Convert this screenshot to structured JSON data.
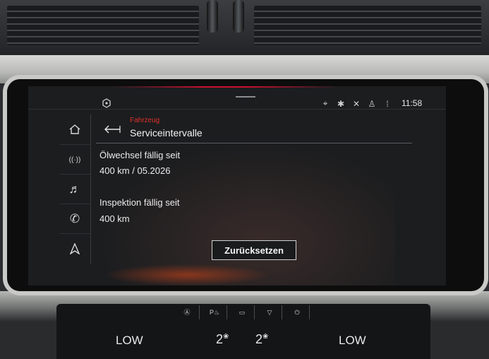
{
  "status_bar": {
    "time": "11:58",
    "icons": [
      "car-icon",
      "location-icon",
      "bluetooth-icon",
      "mute-icon",
      "user-icon",
      "signal-icon"
    ]
  },
  "sidebar": {
    "items": [
      {
        "icon": "home-icon",
        "glyph": "⌂"
      },
      {
        "icon": "radio-icon",
        "glyph": "((·))"
      },
      {
        "icon": "music-icon",
        "glyph": "♬"
      },
      {
        "icon": "phone-icon",
        "glyph": "✆"
      },
      {
        "icon": "navigation-icon",
        "glyph": "◬"
      }
    ]
  },
  "header": {
    "breadcrumb": "Fahrzeug",
    "title": "Serviceintervalle"
  },
  "service": {
    "oil_label": "Ölwechsel fällig seit",
    "oil_value": "400 km / 05.2026",
    "inspection_label": "Inspektion fällig seit",
    "inspection_value": "400 km"
  },
  "actions": {
    "reset_label": "Zurücksetzen"
  },
  "climate": {
    "left_fan": "LOW",
    "right_fan": "LOW",
    "left_level": "2",
    "right_level": "2",
    "level_glyph": "❀"
  },
  "colors": {
    "accent_red": "#e0312b",
    "screen_bg": "#1c1d1f"
  }
}
